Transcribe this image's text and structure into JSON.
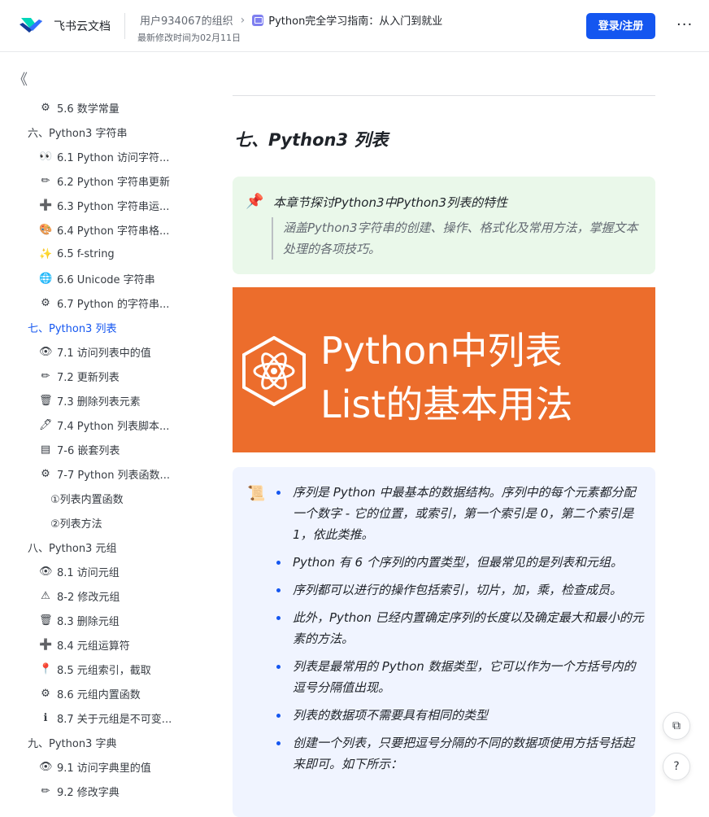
{
  "header": {
    "brand": "飞书云文档",
    "org": "用户934067的组织",
    "separator": "›",
    "doc_title": "Python完全学习指南：从入门到就业",
    "modified": "最新修改时间为02月11日",
    "login_label": "登录/注册",
    "more_label": "···"
  },
  "sidebar": {
    "collapse_label": "《",
    "items": [
      {
        "label": "5.6 数学常量",
        "icon": "⚙",
        "icon_name": "gear-icon",
        "level": 2
      },
      {
        "label": "六、Python3 字符串",
        "icon": "",
        "icon_name": "",
        "level": 1
      },
      {
        "label": "6.1 Python 访问字符...",
        "icon": "👀",
        "icon_name": "eyes-icon",
        "level": 2
      },
      {
        "label": "6.2 Python 字符串更新",
        "icon": "✏",
        "icon_name": "pencil-icon",
        "level": 2
      },
      {
        "label": "6.3 Python 字符串运...",
        "icon": "➕",
        "icon_name": "plus-icon",
        "level": 2
      },
      {
        "label": "6.4 Python 字符串格...",
        "icon": "🎨",
        "icon_name": "palette-icon",
        "level": 2
      },
      {
        "label": "6.5 f-string",
        "icon": "✨",
        "icon_name": "sparkles-icon",
        "level": 2
      },
      {
        "label": "6.6 Unicode 字符串",
        "icon": "🌐",
        "icon_name": "globe-icon",
        "level": 2
      },
      {
        "label": "6.7 Python 的字符串...",
        "icon": "⚙",
        "icon_name": "gear-icon",
        "level": 2
      },
      {
        "label": "七、Python3 列表",
        "icon": "",
        "icon_name": "",
        "level": 1,
        "active": true
      },
      {
        "label": "7.1 访问列表中的值",
        "icon": "👁",
        "icon_name": "eye-icon",
        "level": 2
      },
      {
        "label": "7.2 更新列表",
        "icon": "✏",
        "icon_name": "pencil-icon",
        "level": 2
      },
      {
        "label": "7.3 删除列表元素",
        "icon": "🗑",
        "icon_name": "trash-icon",
        "level": 2
      },
      {
        "label": "7.4 Python 列表脚本...",
        "icon": "🖊",
        "icon_name": "pen-icon",
        "level": 2
      },
      {
        "label": "7-6 嵌套列表",
        "icon": "▤",
        "icon_name": "stack-icon",
        "level": 2
      },
      {
        "label": "7-7 Python 列表函数...",
        "icon": "⚙",
        "icon_name": "gear-icon",
        "level": 2
      },
      {
        "label": "①列表内置函数",
        "icon": "",
        "icon_name": "",
        "level": 3
      },
      {
        "label": "②列表方法",
        "icon": "",
        "icon_name": "",
        "level": 3
      },
      {
        "label": "八、Python3 元组",
        "icon": "",
        "icon_name": "",
        "level": 1
      },
      {
        "label": "8.1 访问元组",
        "icon": "👁",
        "icon_name": "eye-icon",
        "level": 2
      },
      {
        "label": "8-2 修改元组",
        "icon": "⚠",
        "icon_name": "warning-icon",
        "level": 2
      },
      {
        "label": "8.3 删除元组",
        "icon": "🗑",
        "icon_name": "trash-icon",
        "level": 2
      },
      {
        "label": "8.4 元组运算符",
        "icon": "➕",
        "icon_name": "plus-icon",
        "level": 2
      },
      {
        "label": "8.5 元组索引，截取",
        "icon": "📍",
        "icon_name": "pin-icon",
        "level": 2
      },
      {
        "label": "8.6 元组内置函数",
        "icon": "⚙",
        "icon_name": "gear-icon",
        "level": 2
      },
      {
        "label": "8.7 关于元组是不可变...",
        "icon": "ℹ",
        "icon_name": "info-icon",
        "level": 2
      },
      {
        "label": "九、Python3 字典",
        "icon": "",
        "icon_name": "",
        "level": 1
      },
      {
        "label": "9.1 访问字典里的值",
        "icon": "👁",
        "icon_name": "eye-icon",
        "level": 2
      },
      {
        "label": "9.2 修改字典",
        "icon": "✏",
        "icon_name": "pencil-icon",
        "level": 2
      }
    ]
  },
  "content": {
    "heading": "七、Python3 列表",
    "callout_title": "本章节探讨Python3中Python3列表的特性",
    "callout_quote": "涵盖Python3字符串的创建、操作、格式化及常用方法，掌握文本处理的各项技巧。",
    "banner_line1": "Python中列表",
    "banner_line2": "List的基本用法",
    "bullets": [
      "序列是 Python 中最基本的数据结构。序列中的每个元素都分配一个数字 - 它的位置，或索引，第一个索引是 0，第二个索引是 1，依此类推。",
      "Python 有 6 个序列的内置类型，但最常见的是列表和元组。",
      "序列都可以进行的操作包括索引，切片，加，乘，检查成员。",
      "此外，Python 已经内置确定序列的长度以及确定最大和最小的元素的方法。",
      "列表是最常用的 Python 数据类型，它可以作为一个方括号内的逗号分隔值出现。",
      "列表的数据项不需要具有相同的类型",
      "创建一个列表，只要把逗号分隔的不同的数据项使用方括号括起来即可。如下所示："
    ]
  },
  "floating": {
    "doc_action_icon": "⧉",
    "help_icon": "?"
  },
  "colors": {
    "accent": "#1456f0",
    "banner_bg": "#ec6d2c",
    "callout_bg": "#eaf8ea",
    "list_bg": "#f0f4ff"
  }
}
